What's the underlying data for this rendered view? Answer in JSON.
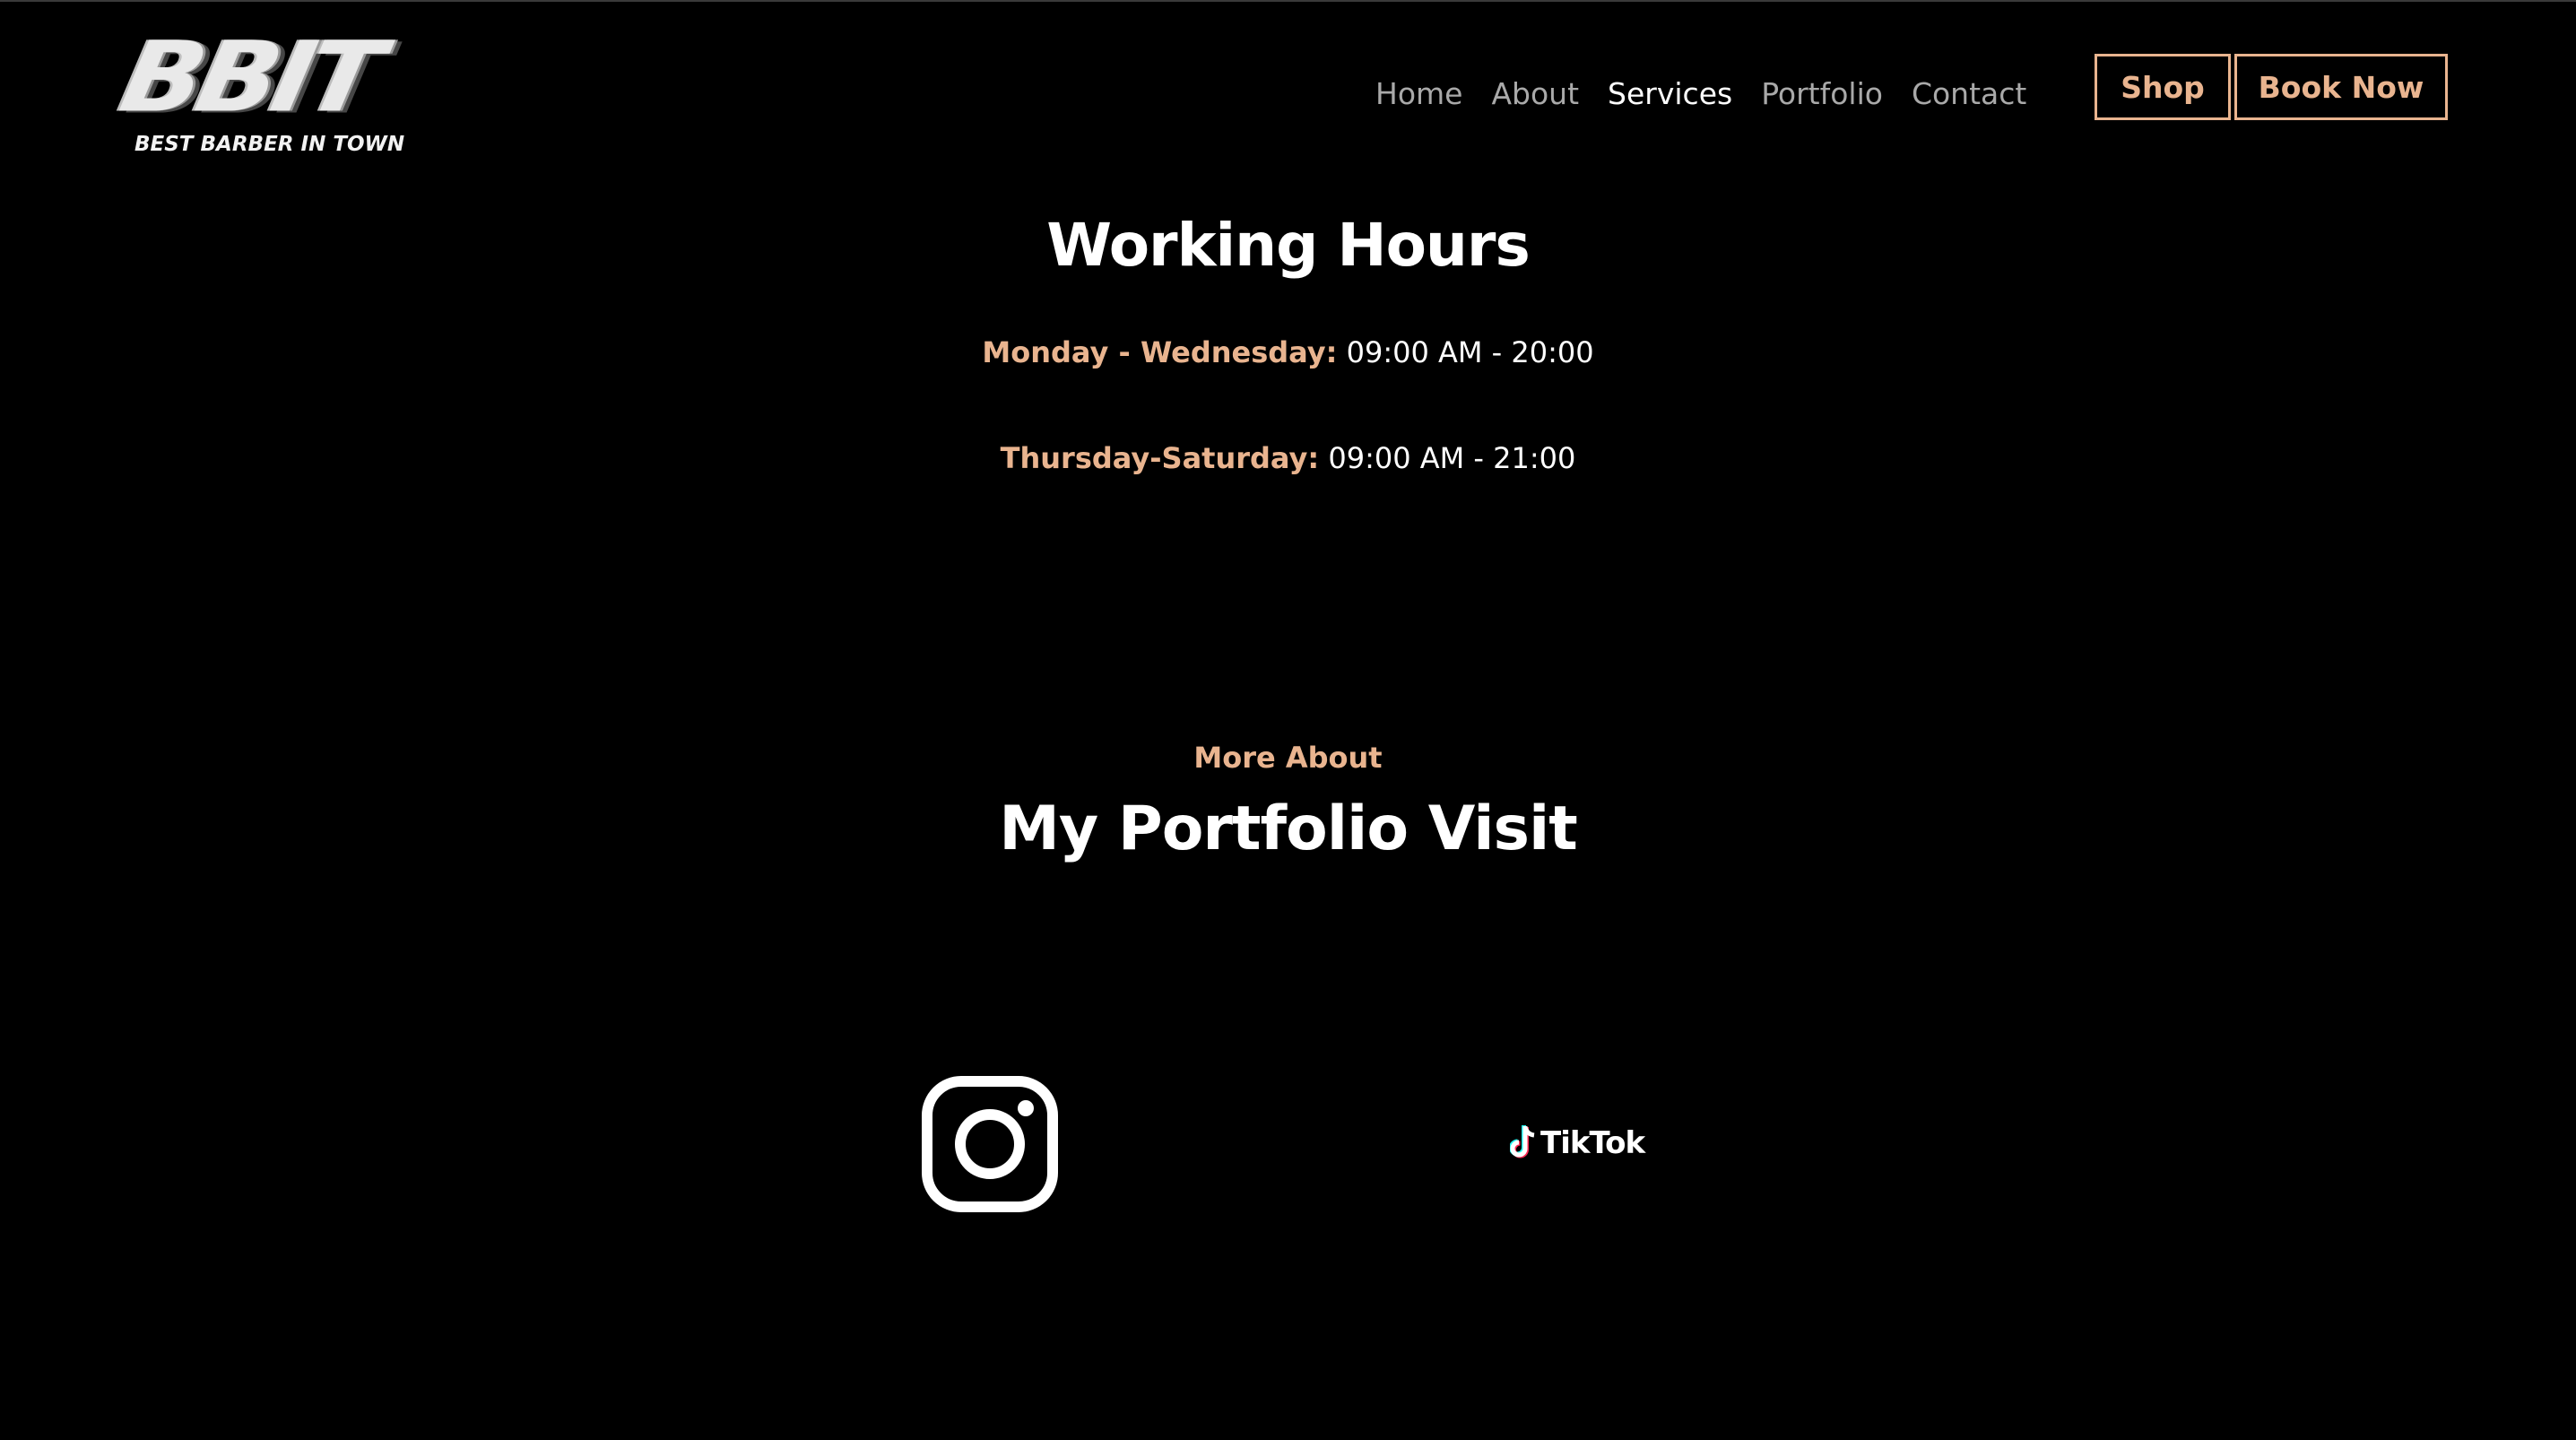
{
  "brand": {
    "logo_text": "BBIT",
    "tagline": "BEST BARBER IN TOWN"
  },
  "nav": {
    "items": [
      {
        "label": "Home",
        "active": false
      },
      {
        "label": "About",
        "active": false
      },
      {
        "label": "Services",
        "active": true
      },
      {
        "label": "Portfolio",
        "active": false
      },
      {
        "label": "Contact",
        "active": false
      }
    ]
  },
  "actions": {
    "shop_label": "Shop",
    "book_label": "Book Now"
  },
  "working_hours": {
    "title": "Working Hours",
    "rows": [
      {
        "day": "Monday - Wednesday:",
        "time": "09:00 AM - 20:00"
      },
      {
        "day": "Thursday-Saturday:",
        "time": "09:00 AM - 21:00"
      }
    ]
  },
  "portfolio": {
    "eyebrow": "More About",
    "title": "My Portfolio Visit"
  },
  "social": {
    "instagram_icon": "instagram-icon",
    "tiktok_label": "TikTok",
    "tiktok_icon": "tiktok-note-icon"
  },
  "colors": {
    "accent": "#e9b48f",
    "background": "#000000",
    "text": "#ffffff",
    "nav_inactive": "#a9a9a9"
  }
}
